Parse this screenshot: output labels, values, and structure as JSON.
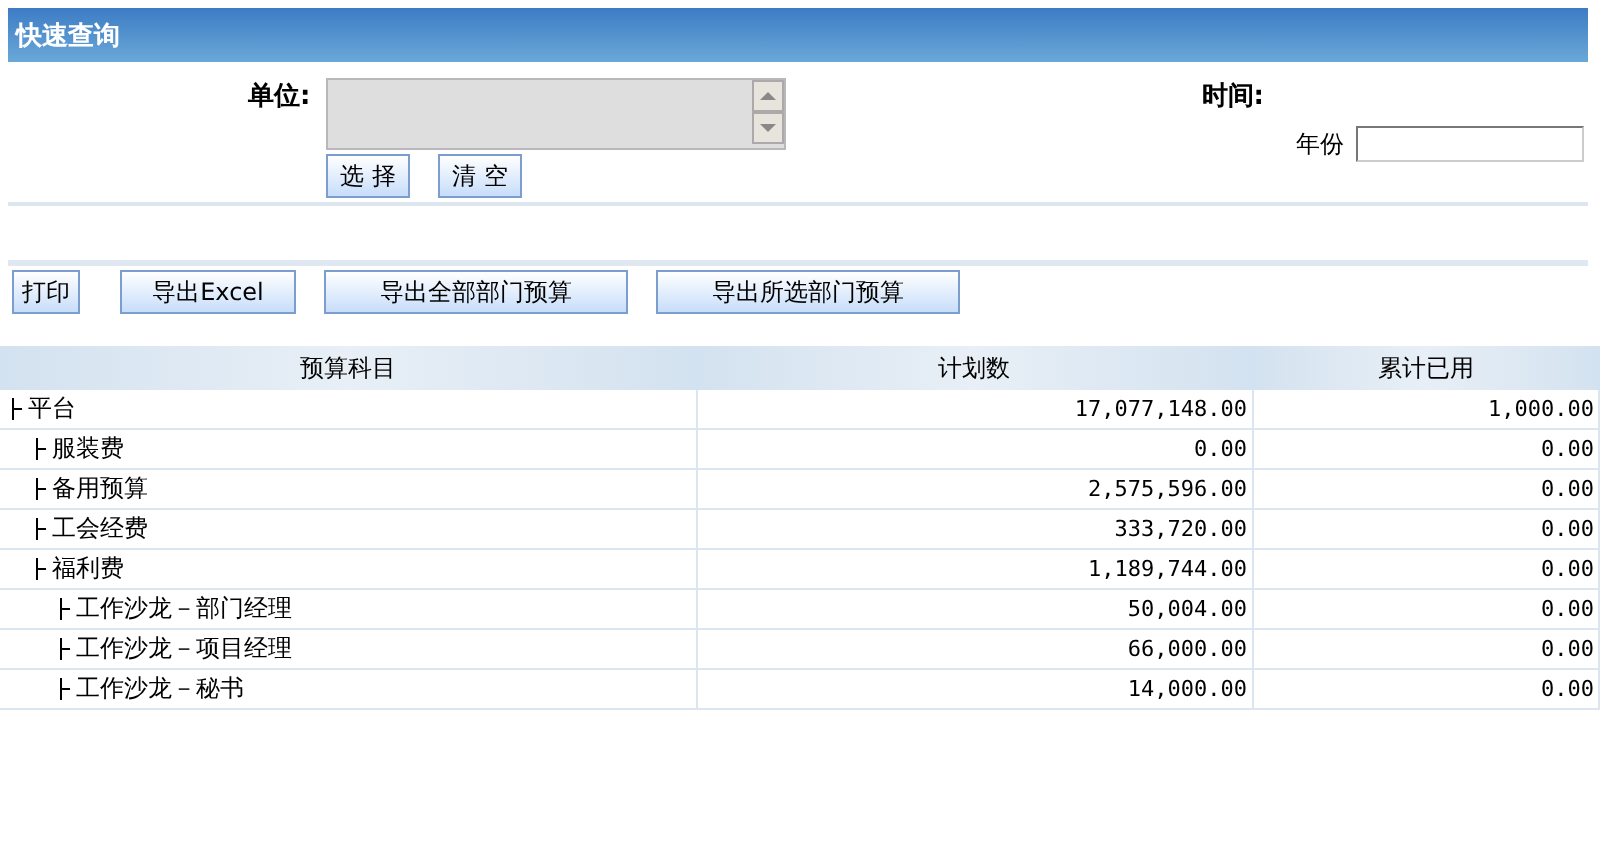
{
  "panel": {
    "title": "快速查询"
  },
  "form": {
    "unit_label": "单位:",
    "unit_buttons": [
      "选 择",
      "清 空"
    ],
    "time_label": "时间:",
    "year_label": "年份"
  },
  "toolbar": [
    "打印",
    "导出Excel",
    "导出全部部门预算",
    "导出所选部门预算"
  ],
  "table": {
    "columns": [
      "预算科目",
      "计划数",
      "累计已用"
    ],
    "rows": [
      {
        "name": "平台",
        "planned": "17,077,148.00",
        "used": "1,000.00",
        "children": [
          {
            "name": "服装费",
            "planned": "0.00",
            "used": "0.00"
          },
          {
            "name": "备用预算",
            "planned": "2,575,596.00",
            "used": "0.00"
          },
          {
            "name": "工会经费",
            "planned": "333,720.00",
            "used": "0.00"
          },
          {
            "name": "福利费",
            "planned": "1,189,744.00",
            "used": "0.00",
            "children": [
              {
                "name": "工作沙龙－部门经理",
                "planned": "50,004.00",
                "used": "0.00"
              },
              {
                "name": "工作沙龙－项目经理",
                "planned": "66,000.00",
                "used": "0.00"
              },
              {
                "name": "工作沙龙－秘书",
                "planned": "14,000.00",
                "used": "0.00"
              }
            ]
          }
        ]
      }
    ]
  }
}
